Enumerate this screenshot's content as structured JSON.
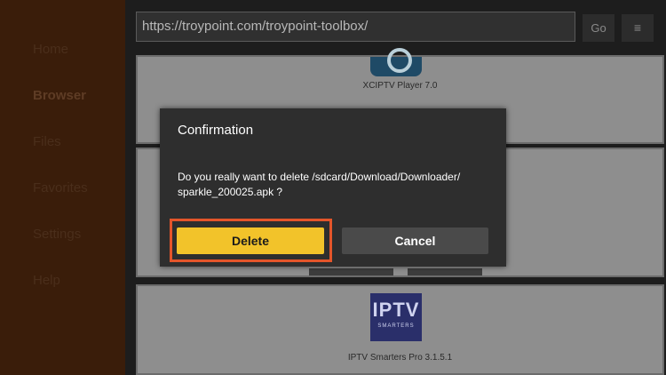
{
  "sidebar": {
    "items": [
      {
        "label": "Home"
      },
      {
        "label": "Browser"
      },
      {
        "label": "Files"
      },
      {
        "label": "Favorites"
      },
      {
        "label": "Settings"
      },
      {
        "label": "Help"
      }
    ],
    "active": "Browser"
  },
  "topbar": {
    "url": "https://troypoint.com/troypoint-toolbox/",
    "go_label": "Go",
    "menu_icon": "≡"
  },
  "list": {
    "items": [
      {
        "caption": "XCIPTV Player 7.0",
        "icon": "xciptv-icon"
      },
      {
        "caption": "IPTV Smarters Pro 3.1.5.1",
        "icon": "iptv-smarters-icon",
        "icon_text": "IPTV",
        "icon_subtext": "SMARTERS"
      }
    ]
  },
  "dialog": {
    "title": "Confirmation",
    "message": "Do you really want to delete /sdcard/Download/Downloader/ sparkle_200025.apk ?",
    "delete_label": "Delete",
    "cancel_label": "Cancel"
  },
  "colors": {
    "accent": "#f2c32a",
    "highlight": "#e4552a",
    "sidebar_bg": "#3a1d0a",
    "dialog_bg": "#2e2e2e"
  }
}
